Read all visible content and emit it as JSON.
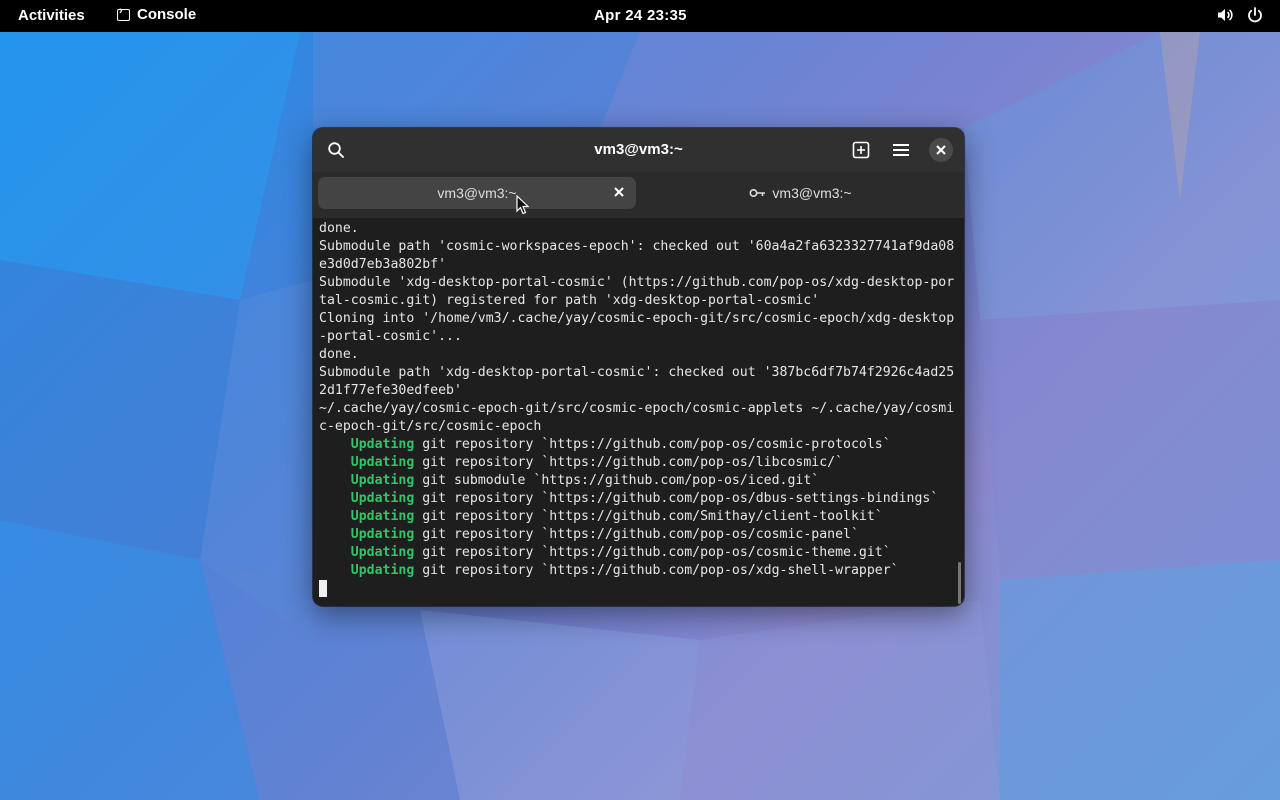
{
  "topbar": {
    "activities": "Activities",
    "app_name": "Console",
    "app_icon": "terminal-icon",
    "clock": "Apr 24  23:35",
    "icons": [
      "volume-icon",
      "power-icon"
    ]
  },
  "window": {
    "title": "vm3@vm3:~",
    "tabs": [
      {
        "label": "vm3@vm3:~",
        "active": true
      },
      {
        "label": "vm3@vm3:~",
        "active": false,
        "icon": "key-icon"
      }
    ]
  },
  "terminal": {
    "lines": [
      "done.",
      "Submodule path 'cosmic-workspaces-epoch': checked out '60a4a2fa6323327741af9da08",
      "e3d0d7eb3a802bf'",
      "Submodule 'xdg-desktop-portal-cosmic' (https://github.com/pop-os/xdg-desktop-por",
      "tal-cosmic.git) registered for path 'xdg-desktop-portal-cosmic'",
      "Cloning into '/home/vm3/.cache/yay/cosmic-epoch-git/src/cosmic-epoch/xdg-desktop",
      "-portal-cosmic'...",
      "done.",
      "Submodule path 'xdg-desktop-portal-cosmic': checked out '387bc6df7b74f2926c4ad25",
      "2d1f77efe30edfeeb'",
      "~/.cache/yay/cosmic-epoch-git/src/cosmic-epoch/cosmic-applets ~/.cache/yay/cosmi",
      "c-epoch-git/src/cosmic-epoch"
    ],
    "updates": [
      {
        "keyword": "Updating",
        "text": " git repository `https://github.com/pop-os/cosmic-protocols`"
      },
      {
        "keyword": "Updating",
        "text": " git repository `https://github.com/pop-os/libcosmic/`"
      },
      {
        "keyword": "Updating",
        "text": " git submodule `https://github.com/pop-os/iced.git`"
      },
      {
        "keyword": "Updating",
        "text": " git repository `https://github.com/pop-os/dbus-settings-bindings`"
      },
      {
        "keyword": "Updating",
        "text": " git repository `https://github.com/Smithay/client-toolkit`"
      },
      {
        "keyword": "Updating",
        "text": " git repository `https://github.com/pop-os/cosmic-panel`"
      },
      {
        "keyword": "Updating",
        "text": " git repository `https://github.com/pop-os/cosmic-theme.git`"
      },
      {
        "keyword": "Updating",
        "text": " git repository `https://github.com/pop-os/xdg-shell-wrapper`"
      }
    ],
    "update_color": "#33c36a"
  }
}
